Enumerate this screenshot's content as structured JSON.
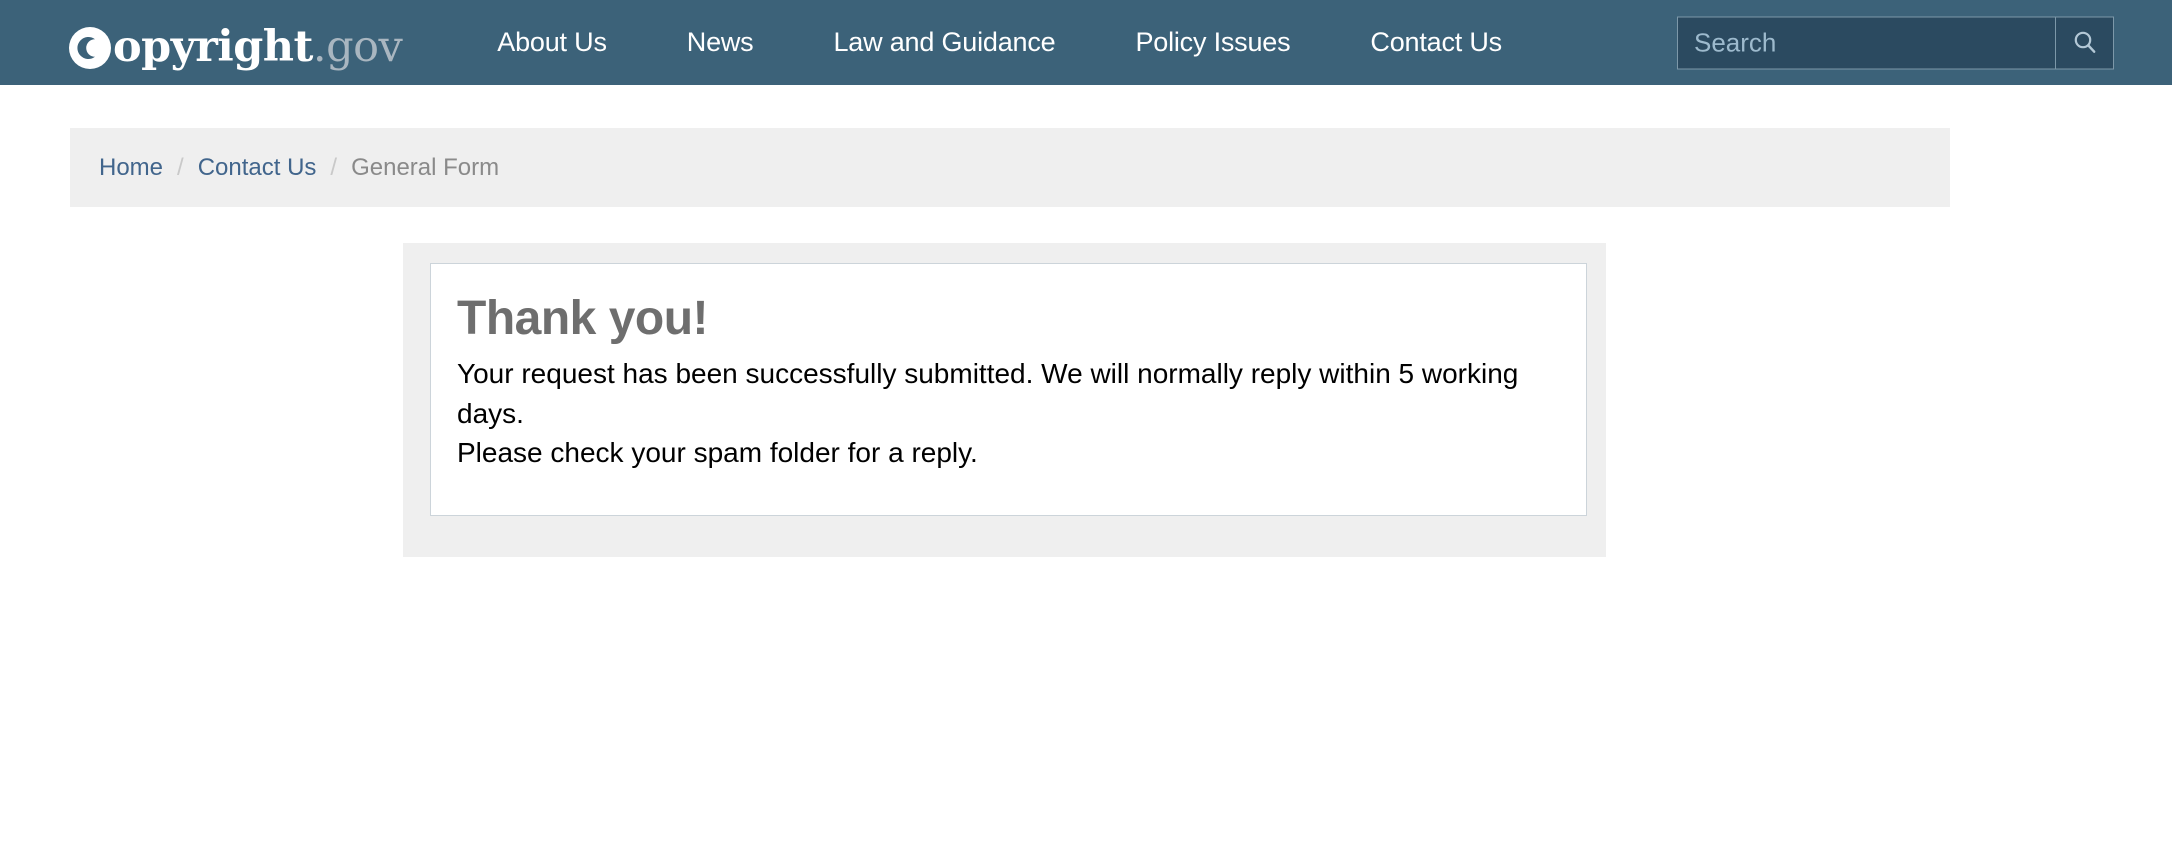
{
  "header": {
    "brand": {
      "c_glyph": "copyright-c",
      "name": "opyright",
      "tld": ".gov"
    },
    "nav": [
      {
        "label": "About Us"
      },
      {
        "label": "News"
      },
      {
        "label": "Law and Guidance"
      },
      {
        "label": "Policy Issues"
      },
      {
        "label": "Contact Us"
      }
    ],
    "search": {
      "placeholder": "Search",
      "value": "",
      "button_icon": "search-icon"
    },
    "bar_color": "#3c6279",
    "search_field_color": "#2b4a60"
  },
  "breadcrumb": {
    "separator": "/",
    "items": [
      {
        "label": "Home",
        "current": false
      },
      {
        "label": "Contact Us",
        "current": false
      },
      {
        "label": "General Form",
        "current": true
      }
    ],
    "link_color": "#41658c",
    "current_color": "#8a8a8a"
  },
  "main": {
    "confirmation": {
      "heading": "Thank you!",
      "lines": [
        "Your request has been successfully submitted. We will normally reply within 5 working days.",
        "Please check your spam folder for a reply."
      ],
      "heading_color": "#6e6e6e",
      "panel_color": "#efefef"
    }
  }
}
